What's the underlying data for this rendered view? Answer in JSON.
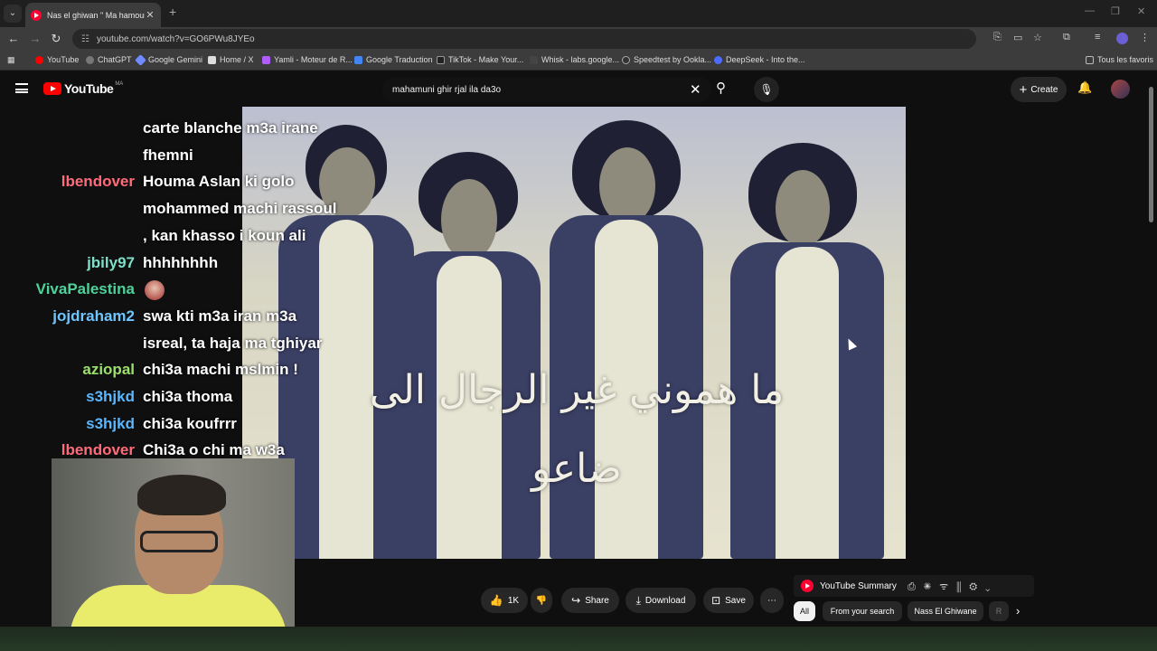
{
  "browser": {
    "tab_title": "Nas el ghiwan \" Ma hamouni\"",
    "url": "youtube.com/watch?v=GO6PWu8JYEo",
    "bookmarks": [
      {
        "label": "YouTube",
        "color": "#ff0000"
      },
      {
        "label": "ChatGPT",
        "color": "#777777"
      },
      {
        "label": "Google Gemini",
        "color": "#6f8bff"
      },
      {
        "label": "Home / X",
        "color": "#dddddd"
      },
      {
        "label": "Yamli - Moteur de R...",
        "color": "#b05cff"
      },
      {
        "label": "Google Traduction",
        "color": "#4285f4"
      },
      {
        "label": "TikTok - Make Your...",
        "color": "#222222"
      },
      {
        "label": "Whisk - labs.google...",
        "color": "#444444"
      },
      {
        "label": "Speedtest by Ookla...",
        "color": "#333333"
      },
      {
        "label": "DeepSeek - Into the...",
        "color": "#4d6bfe"
      },
      {
        "label": "Tous les favoris",
        "color": "#888888"
      }
    ]
  },
  "youtube": {
    "logo_text": "YouTube",
    "country_code": "MA",
    "search_query": "mahamuni ghir rjal ila da3o",
    "create_label": "Create"
  },
  "video": {
    "arabic_line1": "ما هموني غير الرجال الى",
    "arabic_line2": "ضاعو"
  },
  "chat": [
    {
      "author": "",
      "text": "carte blanche m3a irane",
      "color": "#ffffff"
    },
    {
      "author": "",
      "text": "fhemni",
      "color": "#ffffff"
    },
    {
      "author": "lbendover",
      "text": "Houma Aslan ki golo",
      "color": "#ff6b7a"
    },
    {
      "author": "",
      "text": "mohammed machi rassoul",
      "color": "#ffffff"
    },
    {
      "author": "",
      "text": ", kan khasso i koun ali",
      "color": "#ffffff"
    },
    {
      "author": "jbily97",
      "text": "hhhhhhhh",
      "color": "#7ee0c8"
    },
    {
      "author": "VivaPalestina",
      "text": "",
      "color": "#4ed29a"
    },
    {
      "author": "jojdraham2",
      "text": "swa kti m3a iran m3a",
      "color": "#6fc6ff"
    },
    {
      "author": "",
      "text": "isreal, ta haja ma tghiyar",
      "color": "#ffffff"
    },
    {
      "author": "aziopal",
      "text": "chi3a machi mslmin !",
      "color": "#9be06a"
    },
    {
      "author": "s3hjkd",
      "text": "chi3a thoma",
      "color": "#5ab7ff"
    },
    {
      "author": "s3hjkd",
      "text": "chi3a koufrrr",
      "color": "#5ab7ff"
    },
    {
      "author": "lbendover",
      "text": "Chi3a o chi ma w3a",
      "color": "#ff6b7a"
    }
  ],
  "actions": {
    "likes": "1K",
    "share": "Share",
    "download": "Download",
    "save": "Save"
  },
  "summary": {
    "title": "YouTube Summary"
  },
  "chips": [
    {
      "label": "All",
      "active": true
    },
    {
      "label": "From your search",
      "active": false
    },
    {
      "label": "Nass El Ghiwane",
      "active": false
    },
    {
      "label": "R",
      "active": false
    }
  ]
}
